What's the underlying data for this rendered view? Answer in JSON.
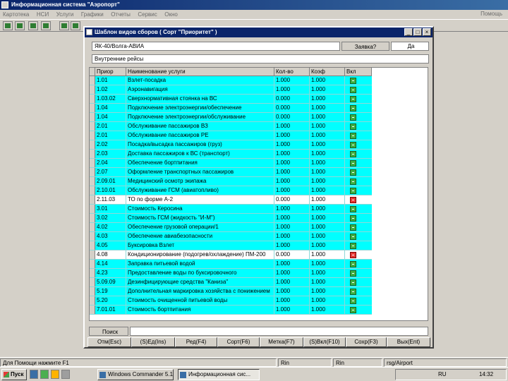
{
  "app": {
    "title": "Информационная система \"Аэропорт\"",
    "menu": [
      "Картотека",
      "НСИ",
      "Услуги",
      "Графики",
      "Отчеты",
      "Сервис",
      "Окно"
    ],
    "help": "Помощь"
  },
  "dialog": {
    "title": "Шаблон видов сборов ( Сорт \"Приоритет\" )",
    "minimize": "_",
    "maximize": "□",
    "close": "×",
    "airline": "ЯК-40/Волга-АВИА",
    "request_label": "Заявка?",
    "request_value": "Да",
    "group": "Внутренние рейсы"
  },
  "columns": {
    "code": "Приор",
    "name": "Наименование услуги",
    "qty": "Кол-во",
    "coef": "Коэф",
    "incl": "Вкл"
  },
  "rows": [
    {
      "code": "1.01",
      "name": "Взлет-посадка",
      "qty": "1.000",
      "coef": "1.000",
      "on": true
    },
    {
      "code": "1.02",
      "name": "Аэронавигация",
      "qty": "1.000",
      "coef": "1.000",
      "on": true
    },
    {
      "code": "1.03.02",
      "name": "Сверхнормативная стоянка на ВС",
      "qty": "0.000",
      "coef": "1.000",
      "on": true
    },
    {
      "code": "1.04",
      "name": "Подключение электроэнергии/обеспечение",
      "qty": "0.000",
      "coef": "1.000",
      "on": true
    },
    {
      "code": "1.04",
      "name": "Подключение электроэнергии/обслуживание",
      "qty": "0.000",
      "coef": "1.000",
      "on": true
    },
    {
      "code": "2.01",
      "name": "Обслуживание пассажиров ВЗ",
      "qty": "1.000",
      "coef": "1.000",
      "on": true
    },
    {
      "code": "2.01",
      "name": "Обслуживание пассажиров РЕ",
      "qty": "1.000",
      "coef": "1.000",
      "on": true
    },
    {
      "code": "2.02",
      "name": "Посадка/высадка пассажиров (груз)",
      "qty": "1.000",
      "coef": "1.000",
      "on": true
    },
    {
      "code": "2.03",
      "name": "Доставка пассажиров к ВС (транспорт)",
      "qty": "1.000",
      "coef": "1.000",
      "on": true
    },
    {
      "code": "2.04",
      "name": "Обеспечение бортпитания",
      "qty": "1.000",
      "coef": "1.000",
      "on": true
    },
    {
      "code": "2.07",
      "name": "Оформление транспортных пассажиров",
      "qty": "1.000",
      "coef": "1.000",
      "on": true
    },
    {
      "code": "2.09.01",
      "name": "Медицинский осмотр экипажа",
      "qty": "1.000",
      "coef": "1.000",
      "on": true
    },
    {
      "code": "2.10.01",
      "name": "Обслуживание ГСМ (авиатопливо)",
      "qty": "1.000",
      "coef": "1.000",
      "on": true
    },
    {
      "code": "2.11.03",
      "name": "ТО по форме А-2",
      "qty": "0.000",
      "coef": "1.000",
      "on": false
    },
    {
      "code": "3.01",
      "name": "Стоимость Керосина",
      "qty": "1.000",
      "coef": "1.000",
      "on": true
    },
    {
      "code": "3.02",
      "name": "Стоимость ГСМ (жидкость \"И-М\")",
      "qty": "1.000",
      "coef": "1.000",
      "on": true
    },
    {
      "code": "4.02",
      "name": "Обеспечение грузовой операции/1",
      "qty": "1.000",
      "coef": "1.000",
      "on": true
    },
    {
      "code": "4.03",
      "name": "Обеспечение авиабезопасности",
      "qty": "1.000",
      "coef": "1.000",
      "on": true
    },
    {
      "code": "4.05",
      "name": "Буксировка Взлет",
      "qty": "1.000",
      "coef": "1.000",
      "on": true
    },
    {
      "code": "4.08",
      "name": "Кондиционирование (подогрев/охлаждение) ПМ-200",
      "qty": "0.000",
      "coef": "1.000",
      "on": false
    },
    {
      "code": "4.14",
      "name": "Заправка питьевой водой",
      "qty": "1.000",
      "coef": "1.000",
      "on": true
    },
    {
      "code": "4.23",
      "name": "Предоставление воды по буксировочного",
      "qty": "1.000",
      "coef": "1.000",
      "on": true
    },
    {
      "code": "5.09.09",
      "name": "Дезинфицирующие средства \"Каниза\"",
      "qty": "1.000",
      "coef": "1.000",
      "on": true
    },
    {
      "code": "5.19",
      "name": "Дополнительная маркировка хозяйства с понижением",
      "qty": "1.000",
      "coef": "1.000",
      "on": true
    },
    {
      "code": "5.20",
      "name": "Стоимость очищенной питьевой воды",
      "qty": "1.000",
      "coef": "1.000",
      "on": true
    },
    {
      "code": "7.01.01",
      "name": "Стоимость бортпитания",
      "qty": "1.000",
      "coef": "1.000",
      "on": true
    }
  ],
  "search_label": "Поиск",
  "buttons": [
    "Отм(Esc)",
    "(S)Ед(Ins)",
    "Ред(F4)",
    "Сорт(F6)",
    "Метка(F7)",
    "(S)Вкл(F10)",
    "Сохр(F3)",
    "Вых(Ent)"
  ],
  "statusbar": {
    "hint": "Для Помощи нажмите F1",
    "s2": "Rin",
    "s3": "Rin",
    "s4": "rsg/Airport"
  },
  "taskbar": {
    "start": "Пуск",
    "task1": "Windows Commander 5.1...",
    "task2": "Информационная сис...",
    "tray_lang": "RU",
    "tray_time": "14:32"
  },
  "colors": {
    "row_bg": "#00ffff",
    "selected_bg": "#ffffff",
    "title_bg": "#0a246a"
  }
}
